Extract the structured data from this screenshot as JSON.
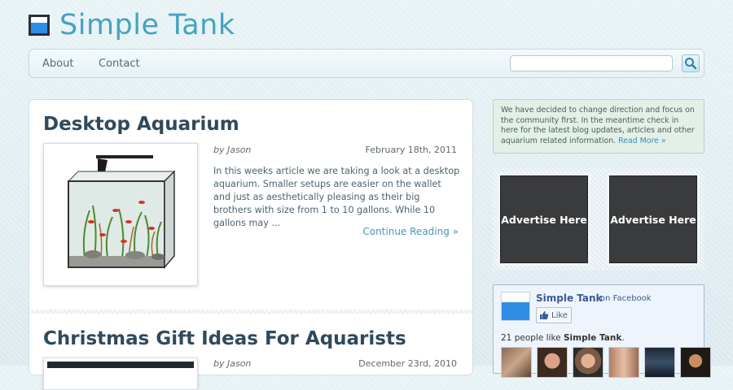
{
  "site": {
    "title": "Simple Tank",
    "logo_icon": "aquarium-logo-icon"
  },
  "nav": {
    "items": [
      "About",
      "Contact"
    ],
    "search_placeholder": "",
    "search_icon": "search-icon"
  },
  "posts": [
    {
      "title": "Desktop Aquarium",
      "author": "by Jason",
      "date": "February 18th, 2011",
      "excerpt": "In this weeks article we are taking a look at a desktop aquarium. Smaller setups are easier on the wallet and just as aesthetically pleasing as their big brothers with size from 1 to 10 gallons. While 10 gallons may ...",
      "more": "Continue Reading »"
    },
    {
      "title": "Christmas Gift Ideas For Aquarists",
      "author": "by Jason",
      "date": "December 23rd, 2010"
    }
  ],
  "sidebar": {
    "notice_text": "We have decided to change direction and focus on the community first. In the meantime check in here for the latest blog updates, articles and other aquarium related information.",
    "notice_link": "Read More »",
    "ads": [
      "Advertise Here",
      "Advertise Here"
    ]
  },
  "facebook": {
    "page_name": "Simple Tank",
    "on_text": "on Facebook",
    "like_label": "Like",
    "count_prefix": "21 people like",
    "count_suffix": ".",
    "faces_count": 6
  },
  "colors": {
    "accent": "#45a3bf",
    "heading": "#2f4a5c",
    "link": "#4b96b8",
    "facebook": "#3b5998"
  }
}
